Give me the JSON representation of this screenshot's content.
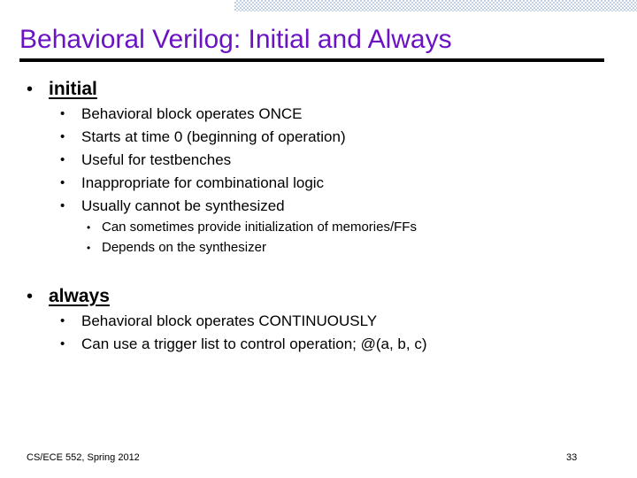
{
  "slide": {
    "title": "Behavioral Verilog: Initial and Always",
    "title_color": "#6b13c4",
    "rule_color": "#000000",
    "deco_bar_color": "#bfd0e8",
    "bullet_glyph": "•",
    "sections": [
      {
        "heading": "initial",
        "items": [
          {
            "level": 2,
            "text": "Behavioral block operates ONCE"
          },
          {
            "level": 2,
            "text": "Starts at time 0 (beginning of operation)"
          },
          {
            "level": 2,
            "text": "Useful for testbenches"
          },
          {
            "level": 2,
            "text": "Inappropriate for combinational logic"
          },
          {
            "level": 2,
            "text": "Usually cannot be synthesized"
          },
          {
            "level": 3,
            "text": "Can sometimes provide initialization of memories/FFs"
          },
          {
            "level": 3,
            "text": "Depends on the synthesizer"
          }
        ]
      },
      {
        "heading": "always",
        "items": [
          {
            "level": 2,
            "text": "Behavioral block operates CONTINUOUSLY"
          },
          {
            "level": 2,
            "text": "Can use a trigger list to control operation; @(a, b, c)"
          }
        ]
      }
    ],
    "footer": {
      "course": "CS/ECE 552, Spring 2012",
      "page_number": "33"
    }
  }
}
